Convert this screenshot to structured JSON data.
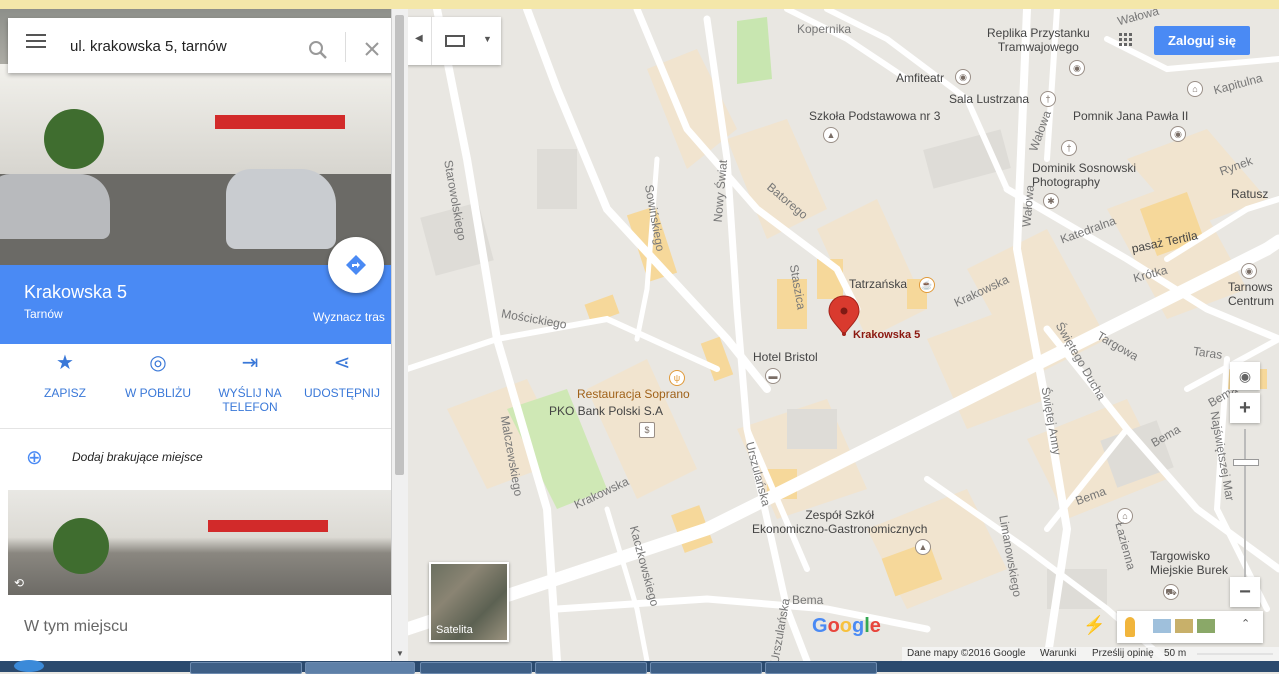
{
  "search": {
    "query": "ul. krakowska 5, tarnów"
  },
  "place": {
    "title": "Krakowska 5",
    "city": "Tarnów",
    "directions_label": "Wyznacz tras"
  },
  "actions": [
    {
      "label": "ZAPISZ"
    },
    {
      "label": "W POBLIŻU"
    },
    {
      "label": "WYŚLIJ NA\nTELEFON"
    },
    {
      "label": "UDOSTĘPNIJ"
    }
  ],
  "add_place": {
    "label": "Dodaj brakujące miejsce"
  },
  "section": {
    "title": "W tym miejscu"
  },
  "map_controls": {
    "signin_label": "Zaloguj się",
    "satellite_label": "Satelita",
    "zoom_in": "+",
    "zoom_out": "−"
  },
  "map_labels": {
    "pin": "Krakowska 5",
    "kopernika": "Kopernika",
    "walowa_top": "Wałowa",
    "replika": "Replika Przystanku\nTramwajowego",
    "amfiteatr": "Amfiteatr",
    "sala": "Sala Lustrzana",
    "kapitulna": "Kapitulna",
    "szkola": "Szkoła Podstawowa nr 3",
    "pomnik": "Pomnik Jana Pawła II",
    "walowa": "Wałowa",
    "walowa2": "Wałowa",
    "dominik": "Dominik Sosnowski\nPhotography",
    "rynek": "Rynek",
    "ratusz": "Ratusz",
    "katedralna": "Katedralna",
    "pasaz": "pasaż Tertila",
    "krotka": "Krótka",
    "tarnows": "Tarnows\nCentrum",
    "starowolskiego": "Starowolskiego",
    "nowy_swiat": "Nowy Świat",
    "batorego": "Batorego",
    "sowinskiego": "Sowińskiego",
    "staszica": "Staszica",
    "tatrzanska": "Tatrzańska",
    "krakowska_ne": "Krakowska",
    "moscickiego": "Mościckiego",
    "hotel": "Hotel Bristol",
    "targowa": "Targowa",
    "swietego_ducha": "Świętego Ducha",
    "taras": "Taras",
    "restauracja": "Restauracja Soprano",
    "pko": "PKO Bank Polski S.A",
    "swietej_anny": "Świętej Anny",
    "malczewskiego": "Malczewskiego",
    "urszulanska": "Urszulańska",
    "krakowska_sw": "Krakowska",
    "bema": "Bema",
    "bema2": "Bema",
    "bema3": "Bema",
    "bema4": "Bema",
    "najswietszej": "Najświętszej Mar",
    "zespol": "Zespół Szkół\nEkonomiczno-Gastronomicznych",
    "kaczkowskiego": "Kaczkowskiego",
    "limanowskiego": "Limanowskiego",
    "lazienna": "Łazienna",
    "targowisko": "Targowisko\nMiejskie Burek",
    "urszulanska2": "Urszulańska",
    "google": "Google"
  },
  "footer": {
    "dane": "Dane mapy ©2016 Google",
    "warunki": "Warunki",
    "opinie": "Prześlij opinię",
    "scale": "50 m"
  },
  "colors": {
    "accent": "#4a8af4",
    "pin": "#d93a2e",
    "park": "#cfe8b5",
    "building": "#f3dcae"
  }
}
